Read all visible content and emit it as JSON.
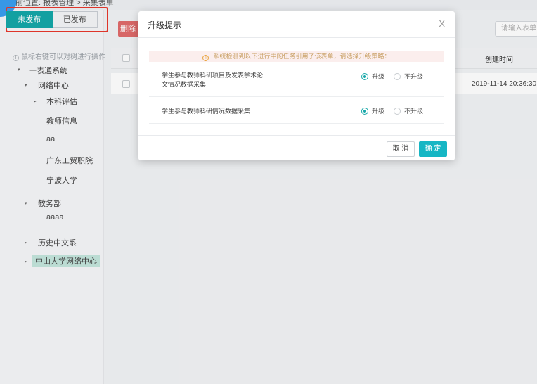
{
  "breadcrumb": {
    "prefix": "前位置:",
    "level1": "报表管理",
    "sep": ">",
    "level2": "采集表单"
  },
  "publish_toggle": {
    "unpublished": "未发布",
    "published": "已发布"
  },
  "sidebar": {
    "tip": "鼠标右键可以对树进行操作",
    "tree": [
      {
        "label": "一表通系统",
        "arrow": "▾"
      },
      {
        "label": "网络中心",
        "arrow": "▾"
      },
      {
        "label": "本科评估",
        "arrow": "▸"
      },
      {
        "label": "教师信息"
      },
      {
        "label": "aa"
      },
      {
        "label": "广东工贸职院"
      },
      {
        "label": "宁波大学"
      },
      {
        "label": "教务部",
        "arrow": "▾"
      },
      {
        "label": "aaaa"
      },
      {
        "label": "历史中文系",
        "arrow": "▸"
      },
      {
        "label": "中山大学网络中心",
        "arrow": "▸"
      }
    ]
  },
  "toolbar": {
    "delete_label": "删除",
    "search_placeholder": "请输入表单名"
  },
  "table": {
    "header_created": "创建时间",
    "rows": [
      {
        "created": "2019-11-14 20:36:30"
      }
    ]
  },
  "modal": {
    "title": "升级提示",
    "close": "X",
    "notice": "系统检测到以下进行中的任务引用了该表单，请选择升级策略：",
    "items": [
      {
        "name_line1": "学生参与教师科研项目及发表学术论",
        "name_line2": "文情况数据采集",
        "upgrade": "升级",
        "no_upgrade": "不升级",
        "selected": "upgrade"
      },
      {
        "name_line1": "学生参与教师科研情况数据采集",
        "upgrade": "升级",
        "no_upgrade": "不升级",
        "selected": "upgrade"
      }
    ],
    "cancel": "取 消",
    "confirm": "确 定"
  },
  "colors": {
    "accent": "#14a7a8",
    "confirm": "#16b6c4",
    "danger": "#e06b6b",
    "highlight_border": "#e8382c"
  }
}
